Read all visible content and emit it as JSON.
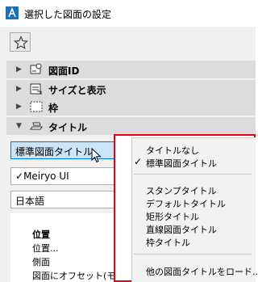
{
  "window": {
    "title": "選択した図面の設定"
  },
  "sections": [
    {
      "label": "図面ID",
      "icon": "drawing-id-icon",
      "expanded": false
    },
    {
      "label": "サイズと表示",
      "icon": "size-display-icon",
      "expanded": false
    },
    {
      "label": "枠",
      "icon": "frame-icon",
      "expanded": false
    },
    {
      "label": "タイトル",
      "icon": "title-icon",
      "expanded": true
    }
  ],
  "controls": {
    "title_style": "標準図面タイトル",
    "font": "Meiryo UI",
    "font_check": "✓",
    "language": "日本語"
  },
  "params": {
    "header": "位置",
    "items": [
      "位置...",
      "側面",
      "図面にオフセット(モデルサイ"
    ]
  },
  "menu": {
    "group1": [
      {
        "label": "タイトルなし",
        "checked": false
      },
      {
        "label": "標準図面タイトル",
        "checked": true
      }
    ],
    "group2": [
      {
        "label": "スタンプタイトル"
      },
      {
        "label": "デフォルトタイトル"
      },
      {
        "label": "矩形タイトル"
      },
      {
        "label": "直線図面タイトル"
      },
      {
        "label": "枠タイトル"
      }
    ],
    "group3": [
      {
        "label": "他の図面タイトルをロード..."
      }
    ],
    "check_glyph": "✓"
  },
  "colors": {
    "highlight_frame": "#e60012",
    "selection": "#cce4f7"
  }
}
